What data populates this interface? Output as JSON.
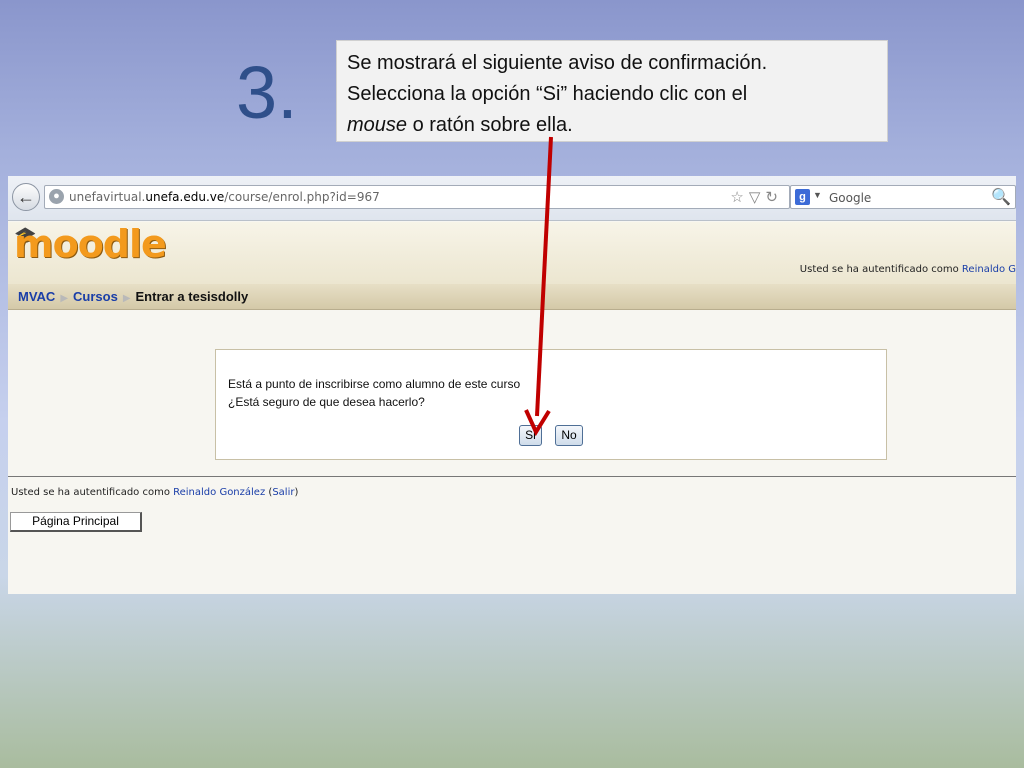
{
  "slide": {
    "step_number": "3.",
    "instruction_line1": "Se mostrará el siguiente aviso de confirmación.",
    "instruction_line2": "Selecciona la opción “Si” haciendo clic con el",
    "instruction_em": "mouse",
    "instruction_line3_rest": " o ratón sobre ella."
  },
  "browser": {
    "url_prefix": "unefavirtual.",
    "url_domain": "unefa.edu.ve",
    "url_path": "/course/enrol.php?id=967",
    "search_placeholder": "Google",
    "search_engine_icon": "g-icon"
  },
  "moodle": {
    "logo": "moodle",
    "header_login_text": "Usted se ha autentificado como ",
    "header_login_user": "Reinaldo G"
  },
  "breadcrumb": {
    "home": "MVAC",
    "courses": "Cursos",
    "current": "Entrar a tesisdolly"
  },
  "dialog": {
    "line1": "Está a punto de inscribirse como alumno de este curso",
    "line2": "¿Está seguro de que desea hacerlo?",
    "yes_label": "Si",
    "no_label": "No"
  },
  "footer": {
    "login_text": "Usted se ha autentificado como ",
    "user_name": "Reinaldo González",
    "logout_open": " (",
    "logout_label": "Salir",
    "logout_close": ")",
    "home_button_label": "Página Principal"
  },
  "colors": {
    "arrow": "#c00000",
    "link": "#1a3ea8",
    "logo": "#f39a1d"
  }
}
